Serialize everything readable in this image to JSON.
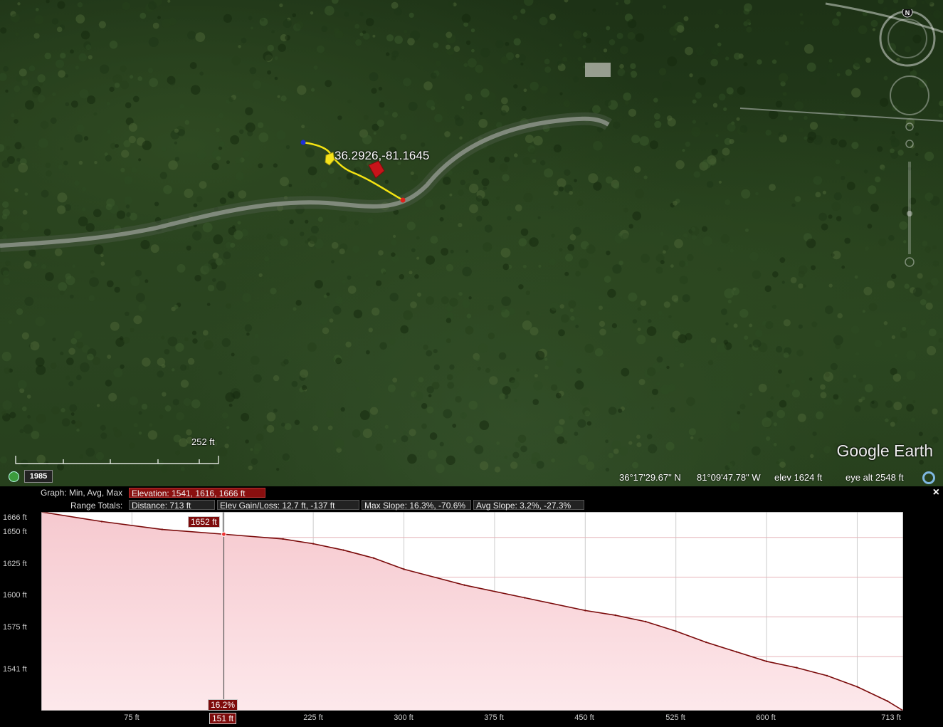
{
  "map": {
    "placemark_label": "36.2926,-81.1645",
    "scale_label": "252 ft",
    "brand": "Google Earth",
    "year_badge": "1985",
    "status": {
      "lat": "36°17'29.67\" N",
      "lon": "81°09'47.78\" W",
      "elev": "elev  1624 ft",
      "eye_alt": "eye alt   2548 ft"
    },
    "compass_label": "N",
    "icons": [
      "history-icon",
      "compass-icon",
      "look-control-icon",
      "zoom-slider-icon",
      "location-icon",
      "placemark-icon",
      "cursor-arrow-icon"
    ],
    "path_color": "#f4e312"
  },
  "profile": {
    "graph_label": "Graph: Min, Avg, Max",
    "elevation_box": "Elevation: 1541, 1616, 1666 ft",
    "range_label": "Range Totals:",
    "distance_box": "Distance: 713 ft",
    "gain_box": "Elev Gain/Loss: 12.7 ft, -137 ft",
    "max_slope_box": "Max Slope: 16.3%, -70.6%",
    "avg_slope_box": "Avg Slope: 3.2%, -27.3%",
    "close_label": "×",
    "cursor_elev_tag": "1652 ft",
    "cursor_slope_tag": "16.2%",
    "cursor_dist_tag": "151 ft",
    "y_ticks": [
      "1666 ft",
      "1650 ft",
      "1625 ft",
      "1600 ft",
      "1575 ft",
      "1541 ft"
    ],
    "x_ticks": [
      "75 ft",
      "225 ft",
      "300 ft",
      "375 ft",
      "450 ft",
      "525 ft",
      "600 ft",
      "713 ft"
    ]
  },
  "chart_data": {
    "type": "area",
    "xlabel": "",
    "ylabel": "",
    "xlim": [
      0,
      713
    ],
    "ylim": [
      1541,
      1666
    ],
    "x_ticks": [
      75,
      150,
      225,
      300,
      375,
      450,
      525,
      600,
      675
    ],
    "y_ticks": [
      1541,
      1575,
      1600,
      1625,
      1650,
      1666
    ],
    "cursor": {
      "x": 151,
      "elev": 1652,
      "slope": "16.2%"
    },
    "series": [
      {
        "x": [
          0,
          50,
          100,
          151,
          200,
          225,
          250,
          275,
          300,
          350,
          400,
          450,
          475,
          500,
          525,
          550,
          575,
          600,
          625,
          650,
          675,
          700,
          713
        ],
        "y": [
          1666,
          1660,
          1655,
          1652,
          1649,
          1646,
          1642,
          1637,
          1630,
          1620,
          1612,
          1604,
          1601,
          1597,
          1591,
          1584,
          1578,
          1572,
          1568,
          1563,
          1556,
          1547,
          1541
        ]
      }
    ],
    "colors": {
      "line": "#7a0a0a",
      "fill_top": "#f6c9cf",
      "fill_bottom": "#fde8eb",
      "grid": "#cccccc",
      "background": "#ffffff"
    }
  }
}
